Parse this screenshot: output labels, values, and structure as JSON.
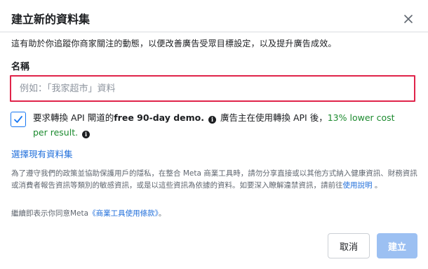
{
  "dialog": {
    "title": "建立新的資料集",
    "description": "這有助於你追蹤你商家關注的動態，以便改善廣告受眾目標設定，以及提升廣告成效。"
  },
  "form": {
    "name_label": "名稱",
    "name_placeholder": "例如：「我家超市」資料",
    "name_value": ""
  },
  "checkbox": {
    "checked": true,
    "text_part1": "要求轉換 API 閘道的",
    "text_bold": "free 90-day demo.",
    "text_part2": "廣告主在使用轉換 API 後，",
    "text_green_1": "13% lower cost",
    "text_green_2": "per result."
  },
  "links": {
    "select_existing": "選擇現有資料集"
  },
  "privacy": {
    "text": "為了遵守我們的政策並協助保護用戶的隱私，在整合 Meta 商業工具時，請勿分享直接或以其他方式納入健康資訊、財務資訊或消費者報告資訊等類別的敏感資訊，或是以這些資訊為依據的資料。如要深入瞭解違禁資訊，請前往",
    "link": "使用說明",
    "suffix": " 。"
  },
  "terms": {
    "prefix": "繼續即表示你同意Meta",
    "link": "《商業工具使用條款》",
    "suffix": "。"
  },
  "buttons": {
    "cancel": "取消",
    "create": "建立"
  },
  "colors": {
    "input_border_highlight": "#e0244a",
    "link": "#216fdb",
    "green": "#1b8a2e",
    "create_disabled": "#9cc0f2"
  }
}
